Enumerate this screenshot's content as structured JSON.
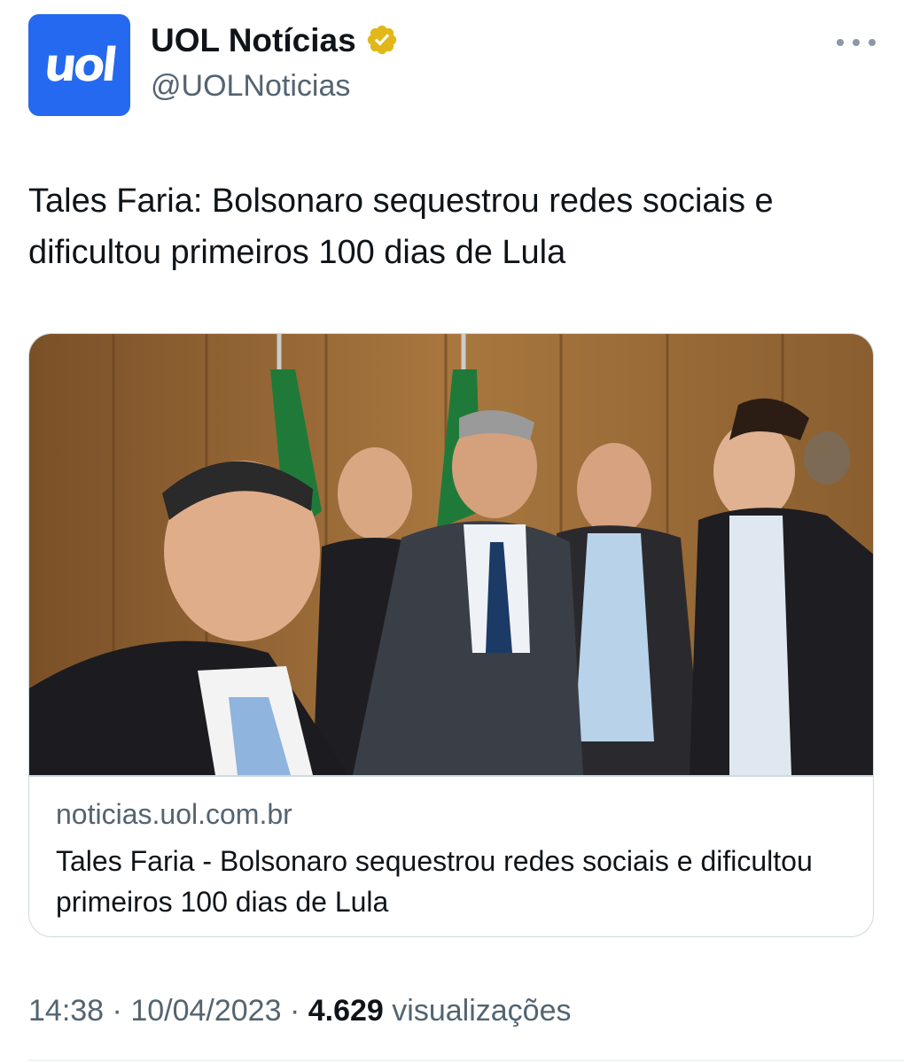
{
  "author": {
    "display_name": "UOL Notícias",
    "handle": "@UOLNoticias",
    "avatar_text": "uol",
    "avatar_color": "#2469f0",
    "verified_badge_color": "#e2b719",
    "verified_badge_icon": "verified-badge-icon"
  },
  "tweet": {
    "text": "Tales Faria: Bolsonaro sequestrou redes sociais e dificultou primeiros 100 dias de Lula"
  },
  "card": {
    "image_icon": "news-photo",
    "domain": "noticias.uol.com.br",
    "title": "Tales Faria - Bolsonaro sequestrou redes sociais e dificultou primeiros 100 dias de Lula"
  },
  "meta": {
    "time": "14:38",
    "separator": "·",
    "date": "10/04/2023",
    "views_count": "4.629",
    "views_label": "visualizações"
  },
  "more_icon": "more-dots-icon"
}
